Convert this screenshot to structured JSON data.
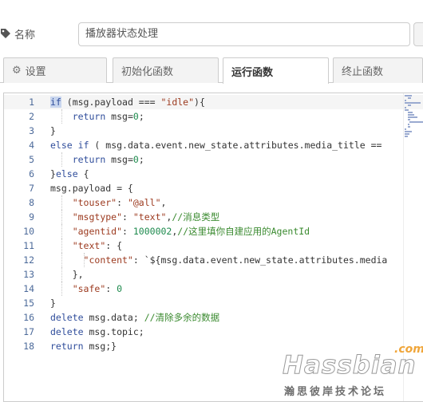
{
  "node": {
    "name_label": "名称",
    "name_value": "播放器状态处理"
  },
  "tabs": [
    {
      "label": "设置",
      "icon": "gear-icon",
      "active": false
    },
    {
      "label": "初始化函数",
      "active": false
    },
    {
      "label": "运行函数",
      "active": true
    },
    {
      "label": "终止函数",
      "active": false
    }
  ],
  "editor": {
    "current_line": 1,
    "lines": [
      {
        "n": "1",
        "text": "if (msg.payload === \"idle\"){"
      },
      {
        "n": "2",
        "text": "    return msg=0;"
      },
      {
        "n": "3",
        "text": "}"
      },
      {
        "n": "4",
        "text": "else if ( msg.data.event.new_state.attributes.media_title =="
      },
      {
        "n": "5",
        "text": "    return msg=0;"
      },
      {
        "n": "6",
        "text": "}else {"
      },
      {
        "n": "7",
        "text": "msg.payload = {"
      },
      {
        "n": "8",
        "text": "    \"touser\": \"@all\","
      },
      {
        "n": "9",
        "text": "    \"msgtype\": \"text\",//消息类型"
      },
      {
        "n": "10",
        "text": "    \"agentid\": 1000002,//这里填你自建应用的AgentId"
      },
      {
        "n": "11",
        "text": "    \"text\": {"
      },
      {
        "n": "12",
        "text": "      \"content\": `${msg.data.event.new_state.attributes.media"
      },
      {
        "n": "13",
        "text": "    },"
      },
      {
        "n": "14",
        "text": "    \"safe\": 0"
      },
      {
        "n": "15",
        "text": "}"
      },
      {
        "n": "16",
        "text": "delete msg.data; //清除多余的数据"
      },
      {
        "n": "17",
        "text": "delete msg.topic;"
      },
      {
        "n": "18",
        "text": "return msg;}"
      }
    ]
  },
  "watermark": {
    "brand": "Hassbian",
    "tld": ".com",
    "subtitle": "瀚思彼岸技术论坛"
  }
}
